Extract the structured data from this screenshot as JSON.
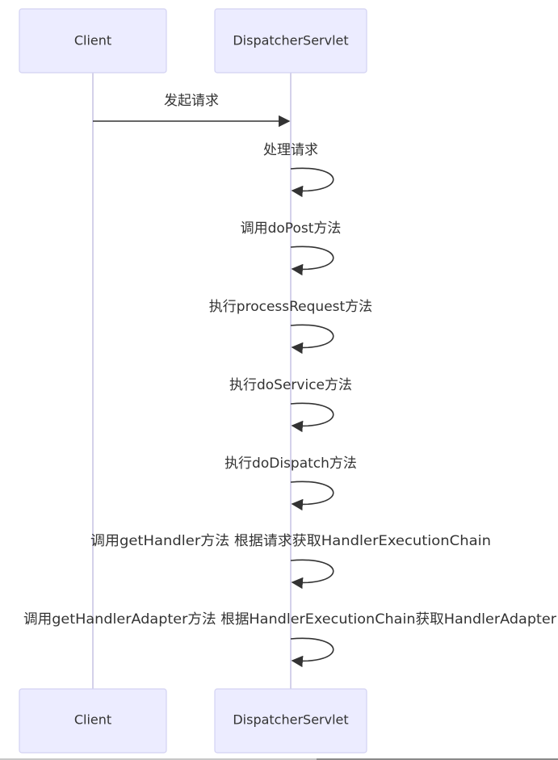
{
  "participants": {
    "client": "Client",
    "dispatcher": "DispatcherServlet"
  },
  "messages": {
    "m0": "发起请求",
    "m1": "处理请求",
    "m2": "调用doPost方法",
    "m3": "执行processRequest方法",
    "m4": "执行doService方法",
    "m5": "执行doDispatch方法",
    "m6": "调用getHandler方法 根据请求获取HandlerExecutionChain",
    "m7": "调用getHandlerAdapter方法 根据HandlerExecutionChain获取HandlerAdapter"
  },
  "colors": {
    "actor_fill": "#ececff",
    "actor_border": "#d3d2f2",
    "lifeline": "#cfcce8",
    "text": "#333333"
  }
}
